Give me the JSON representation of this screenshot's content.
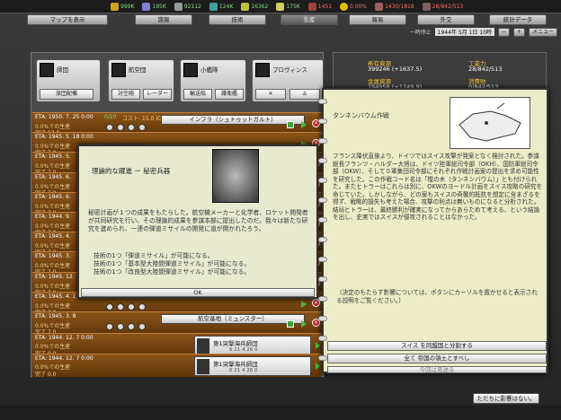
{
  "resources_bar": [
    {
      "icon": "money-icon",
      "value": "999K",
      "color": "#7fe07f"
    },
    {
      "icon": "men-icon",
      "value": "195K",
      "color": "#7fe07f"
    },
    {
      "icon": "steel-icon",
      "value": "92112",
      "color": "#7fe07f"
    },
    {
      "icon": "oil-icon",
      "value": "124K",
      "color": "#7fe07f"
    },
    {
      "icon": "rare-icon",
      "value": "16362",
      "color": "#7fe07f"
    },
    {
      "icon": "supply-icon",
      "value": "175K",
      "color": "#7fe07f"
    },
    {
      "icon": "manpower-icon",
      "value": "1451",
      "color": "#ff6a6a"
    },
    {
      "icon": "nuke-icon",
      "value": "0.00%",
      "color": "#ff6a6a"
    },
    {
      "icon": "transport-icon",
      "value": "1430/1818",
      "color": "#ff6a6a"
    },
    {
      "icon": "escort-icon",
      "value": "28/842/513",
      "color": "#ff6a6a"
    }
  ],
  "nav": {
    "map": "マップを表示",
    "intel": "諜報",
    "tech": "技術",
    "production": "生産",
    "trade": "貿易",
    "diplomacy": "外交",
    "stats": "統計データ"
  },
  "datebar": {
    "pause": "一時停止",
    "date": "1944年 5月 1日 10時",
    "menu": "メニュー"
  },
  "prod_groups": [
    {
      "label": "師団",
      "sub": [
        "旅団配備"
      ]
    },
    {
      "label": "航空団",
      "sub": [
        "対空砲",
        "レーダー"
      ]
    },
    {
      "label": "小艦隊",
      "sub": [
        "輸送船",
        "護衛艦"
      ]
    },
    {
      "label": "プロヴィンス",
      "sub": [
        "",
        ""
      ]
    }
  ],
  "queue": [
    {
      "eta": "ETA: 1950. 7. 25 0:00",
      "count": "0/20",
      "cost": "コスト: 15.0 IC",
      "l2": "0.0%での生産",
      "l3": "完了 63.0",
      "name": "インフラ（シュトゥットガルト）"
    },
    {
      "eta": "ETA: 1945. 5. 18 0:00",
      "count": "",
      "cost": "",
      "l2": "0.0%での生産",
      "l3": "完了 7.0",
      "name": ""
    },
    {
      "eta": "ETA: 1945. 5.",
      "count": "",
      "cost": "",
      "l2": "0.0%での生産",
      "l3": "完了 7.0",
      "name": ""
    },
    {
      "eta": "ETA: 1945. 6.",
      "count": "",
      "cost": "",
      "l2": "0.0%での生産",
      "l3": "完了 7.0",
      "name": ""
    },
    {
      "eta": "ETA: 1945. 6.",
      "count": "",
      "cost": "",
      "l2": "0.0%での生産",
      "l3": "完了 7.0",
      "name": ""
    },
    {
      "eta": "ETA: 1944. 9.",
      "count": "",
      "cost": "",
      "l2": "0.0%での生産",
      "l3": "完了 7.0",
      "name": ""
    },
    {
      "eta": "ETA: 1945. 4.",
      "count": "",
      "cost": "",
      "l2": "0.0%での生産",
      "l3": "完了 7.0",
      "name": ""
    },
    {
      "eta": "ETA: 1945. 3.",
      "count": "",
      "cost": "",
      "l2": "0.0%での生産",
      "l3": "完了 7.0",
      "name": ""
    },
    {
      "eta": "ETA: 1945. 12.",
      "count": "",
      "cost": "",
      "l2": "0.0%での生産",
      "l3": "完了 7.0",
      "name": ""
    },
    {
      "eta": "ETA: 1945. 4. 1",
      "count": "",
      "cost": "",
      "l2": "0.0%での生産",
      "l3": "完了 7.0",
      "name": ""
    },
    {
      "eta": "ETA: 1945. 3. 8",
      "count": "",
      "cost": "",
      "l2": "0.0%での生産",
      "l3": "完了 7.0",
      "name": "航空基地（ミュンスター）"
    }
  ],
  "unit_rows": [
    {
      "eta": "ETA: 1944. 12. 7 0:00",
      "count": "0/1",
      "cost": "コスト: 10.9 IC",
      "l2": "0.0%での生産",
      "l3": "完了 0.0",
      "name": "第1突撃海兵師団",
      "nums": "6  21  4  26  0"
    },
    {
      "eta": "ETA: 1944. 12. 7 0:00",
      "count": "0/1",
      "cost": "コスト: 10.9 IC",
      "l2": "0.0%での生産",
      "l3": "完了 0.0",
      "name": "第1突撃海兵師団",
      "nums": "6  21  4  26  0"
    }
  ],
  "tech_popup": {
    "title": "理論的な躍進 ー 秘密兵器",
    "body": "秘密計画が１つの成果をもたらした。航空機メーカーと化学者、ロケット開発者が共同研究を行い、その理論的成果を参謀本部に提出したのだ。我々は新たな研究を進められ、一連の弾道ミサイルの開発に道が開かれたろう。",
    "effects": [
      "技術の1つ「弾道ミサイル」が可能になる。",
      "技術の1つ「基本型大陸間弾道ミサイル」が可能になる。",
      "技術の1つ「改良型大陸間弾道ミサイル」が可能になる。"
    ],
    "ok": "OK"
  },
  "right_resources": [
    {
      "label": "希有資源",
      "value": "399246 (+1637.5)"
    },
    {
      "label": "金属資源",
      "value": "194958 (+1249.9)"
    },
    {
      "label": "工業力",
      "value": "28/842/513"
    },
    {
      "label": "消費財",
      "value": "0/842/513"
    }
  ],
  "event_popup": {
    "title": "タンネンバウム作戦",
    "body": "フランス降伏直後より、ドイツではスイス攻撃が発案となく検討された。参謀総長フランツ・ハルダー大将は、ドイツ陸軍総司令部（OKH）、国防軍総司令部（OKW）、そして０軍集団司令部にそれぞれ作戦計画案の提出を求め可能性を研究した。この作戦コード名は「樅の木（タンネンバウム）」とも付けられた。またヒトラーはこれらは別に、OKWのヨードル計画をスイス攻略の研究を命じていた。しかしながら、どの案もスイスの奇襲的抵抗を想定に含まざるを得ず、戦略的損失も考えた場合、攻撃の利点は無いものになると分析された。結局ヒトラーは、最終勝利が確実になってからあらためて考える、という結論を出し、史実ではスイスが侵攻されることはなかった。",
    "note": "（決定のもたらす影響については、ボタンにカーソルを置かせると表示される説明をご覧ください。）",
    "options": [
      "スイス を同盟国と分割する",
      "全て 帝国の領土とすべし",
      "今回は見送る"
    ]
  },
  "bottom_button": "ただちに影響はない。"
}
